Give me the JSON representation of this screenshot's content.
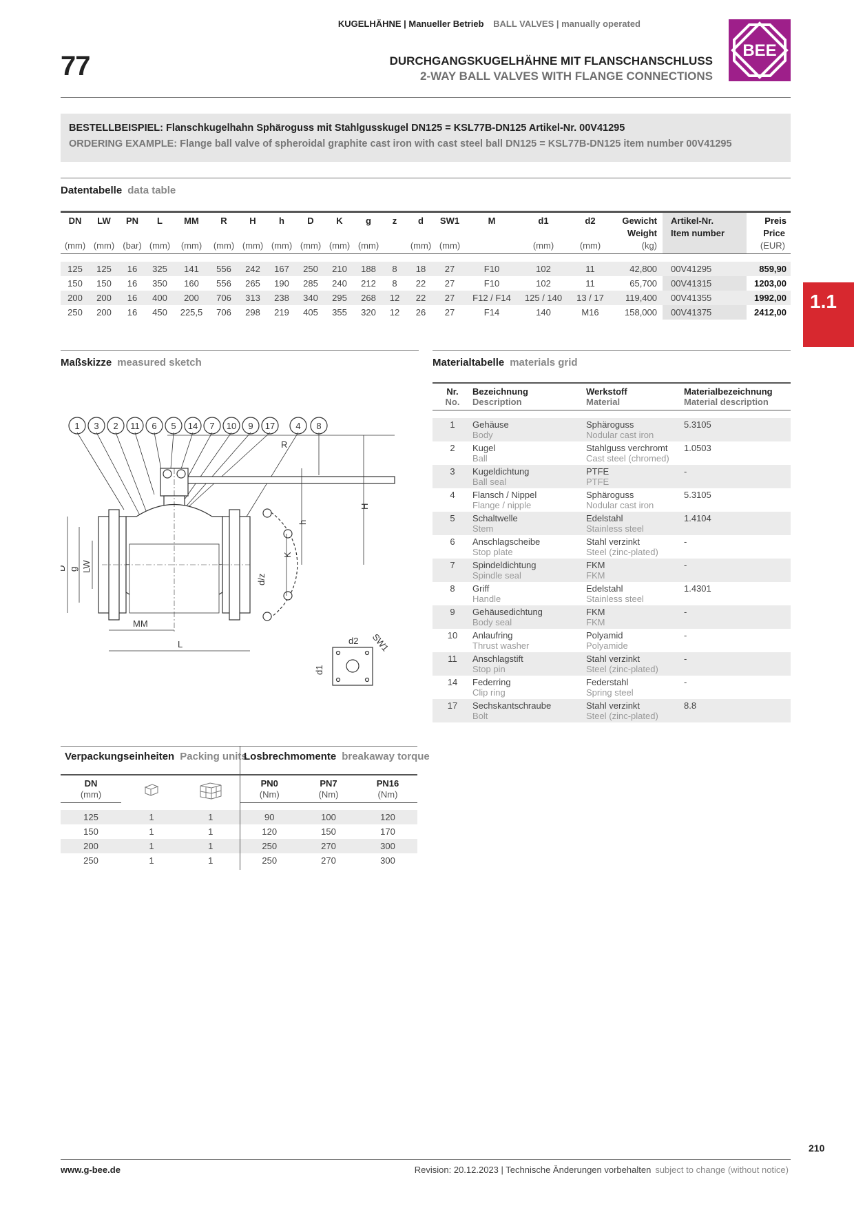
{
  "header": {
    "category_de": "KUGELHÄHNE | Manueller Betrieb",
    "category_en": "BALL VALVES | manually operated",
    "series_number": "77",
    "title_de": "DURCHGANGSKUGELHÄHNE MIT FLANSCHANSCHLUSS",
    "title_en": "2-WAY BALL VALVES WITH FLANGE CONNECTIONS",
    "logo_text": "BEE",
    "logo_color": "#9e1f8a"
  },
  "ordering_example": {
    "de": "BESTELLBEISPIEL: Flanschkugelhahn Sphäroguss mit Stahlgusskugel DN125 = KSL77B-DN125 Artikel-Nr. 00V41295",
    "en": "ORDERING EXAMPLE: Flange ball valve of spheroidal graphite cast iron with cast steel ball DN125 = KSL77B-DN125 item number 00V41295"
  },
  "data_table": {
    "title_de": "Datentabelle",
    "title_en": "data table",
    "headers": [
      "DN",
      "LW",
      "PN",
      "L",
      "MM",
      "R",
      "H",
      "h",
      "D",
      "K",
      "g",
      "z",
      "d",
      "SW1",
      "M",
      "d1",
      "d2",
      "Gewicht",
      "Artikel-Nr.",
      "Preis"
    ],
    "headers_en": [
      "",
      "",
      "",
      "",
      "",
      "",
      "",
      "",
      "",
      "",
      "",
      "",
      "",
      "",
      "",
      "",
      "",
      "Weight",
      "Item number",
      "Price"
    ],
    "units": [
      "(mm)",
      "(mm)",
      "(bar)",
      "(mm)",
      "(mm)",
      "(mm)",
      "(mm)",
      "(mm)",
      "(mm)",
      "(mm)",
      "(mm)",
      "",
      "(mm)",
      "(mm)",
      "",
      "(mm)",
      "(mm)",
      "(kg)",
      "",
      "(EUR)"
    ],
    "rows": [
      [
        "125",
        "125",
        "16",
        "325",
        "141",
        "556",
        "242",
        "167",
        "250",
        "210",
        "188",
        "8",
        "18",
        "27",
        "F10",
        "102",
        "11",
        "42,800",
        "00V41295",
        "859,90"
      ],
      [
        "150",
        "150",
        "16",
        "350",
        "160",
        "556",
        "265",
        "190",
        "285",
        "240",
        "212",
        "8",
        "22",
        "27",
        "F10",
        "102",
        "11",
        "65,700",
        "00V41315",
        "1203,00"
      ],
      [
        "200",
        "200",
        "16",
        "400",
        "200",
        "706",
        "313",
        "238",
        "340",
        "295",
        "268",
        "12",
        "22",
        "27",
        "F12 / F14",
        "125 / 140",
        "13 / 17",
        "119,400",
        "00V41355",
        "1992,00"
      ],
      [
        "250",
        "200",
        "16",
        "450",
        "225,5",
        "706",
        "298",
        "219",
        "405",
        "355",
        "320",
        "12",
        "26",
        "27",
        "F14",
        "140",
        "M16",
        "158,000",
        "00V41375",
        "2412,00"
      ]
    ]
  },
  "section_tab": "1.1",
  "sketch": {
    "title_de": "Maßskizze",
    "title_en": "measured sketch",
    "balloons": [
      "1",
      "3",
      "2",
      "11",
      "6",
      "5",
      "14",
      "7",
      "10",
      "9",
      "17",
      "4",
      "8"
    ],
    "dim_labels": {
      "R": "R",
      "H": "H",
      "h": "h",
      "K": "K",
      "D": "D",
      "g": "g",
      "LW": "LW",
      "MM": "MM",
      "L": "L",
      "dz": "d/z",
      "d2": "d2",
      "SW1": "SW1",
      "d1": "d1"
    }
  },
  "materials": {
    "title_de": "Materialtabelle",
    "title_en": "materials grid",
    "headers_de": [
      "Nr.",
      "Bezeichnung",
      "Werkstoff",
      "Materialbezeichnung"
    ],
    "headers_en": [
      "No.",
      "Description",
      "Material",
      "Material description"
    ],
    "rows": [
      {
        "nr": "1",
        "de": "Gehäuse",
        "en": "Body",
        "mat_de": "Sphäroguss",
        "mat_en": "Nodular cast iron",
        "spec": "5.3105"
      },
      {
        "nr": "2",
        "de": "Kugel",
        "en": "Ball",
        "mat_de": "Stahlguss verchromt",
        "mat_en": "Cast steel (chromed)",
        "spec": "1.0503"
      },
      {
        "nr": "3",
        "de": "Kugeldichtung",
        "en": "Ball seal",
        "mat_de": "PTFE",
        "mat_en": "PTFE",
        "spec": "-"
      },
      {
        "nr": "4",
        "de": "Flansch / Nippel",
        "en": "Flange / nipple",
        "mat_de": "Sphäroguss",
        "mat_en": "Nodular cast iron",
        "spec": "5.3105"
      },
      {
        "nr": "5",
        "de": "Schaltwelle",
        "en": "Stem",
        "mat_de": "Edelstahl",
        "mat_en": "Stainless steel",
        "spec": "1.4104"
      },
      {
        "nr": "6",
        "de": "Anschlagscheibe",
        "en": "Stop plate",
        "mat_de": "Stahl verzinkt",
        "mat_en": "Steel (zinc-plated)",
        "spec": "-"
      },
      {
        "nr": "7",
        "de": "Spindeldichtung",
        "en": "Spindle seal",
        "mat_de": "FKM",
        "mat_en": "FKM",
        "spec": "-"
      },
      {
        "nr": "8",
        "de": "Griff",
        "en": "Handle",
        "mat_de": "Edelstahl",
        "mat_en": "Stainless steel",
        "spec": "1.4301"
      },
      {
        "nr": "9",
        "de": "Gehäusedichtung",
        "en": "Body seal",
        "mat_de": "FKM",
        "mat_en": "FKM",
        "spec": "-"
      },
      {
        "nr": "10",
        "de": "Anlaufring",
        "en": "Thrust washer",
        "mat_de": "Polyamid",
        "mat_en": "Polyamide",
        "spec": "-"
      },
      {
        "nr": "11",
        "de": "Anschlagstift",
        "en": "Stop pin",
        "mat_de": "Stahl verzinkt",
        "mat_en": "Steel (zinc-plated)",
        "spec": "-"
      },
      {
        "nr": "14",
        "de": "Federring",
        "en": "Clip ring",
        "mat_de": "Federstahl",
        "mat_en": "Spring steel",
        "spec": "-"
      },
      {
        "nr": "17",
        "de": "Sechskantschraube",
        "en": "Bolt",
        "mat_de": "Stahl verzinkt",
        "mat_en": "Steel (zinc-plated)",
        "spec": "8.8"
      }
    ]
  },
  "packing": {
    "title_de": "Verpackungseinheiten",
    "title_en": "Packing units",
    "torque_title_de": "Losbrechmomente",
    "torque_title_en": "breakaway torque",
    "headers": [
      "DN",
      "",
      "",
      "PN0",
      "PN7",
      "PN16"
    ],
    "units": [
      "(mm)",
      "",
      "",
      "(Nm)",
      "(Nm)",
      "(Nm)"
    ],
    "icons": [
      "single-box-icon",
      "multi-box-icon"
    ],
    "rows": [
      [
        "125",
        "1",
        "1",
        "90",
        "100",
        "120"
      ],
      [
        "150",
        "1",
        "1",
        "120",
        "150",
        "170"
      ],
      [
        "200",
        "1",
        "1",
        "250",
        "270",
        "300"
      ],
      [
        "250",
        "1",
        "1",
        "250",
        "270",
        "300"
      ]
    ]
  },
  "footer": {
    "url": "www.g-bee.de",
    "revision_de": "Revision: 20.12.2023 | Technische Änderungen vorbehalten",
    "revision_en": "subject to change (without notice)",
    "page": "210"
  }
}
